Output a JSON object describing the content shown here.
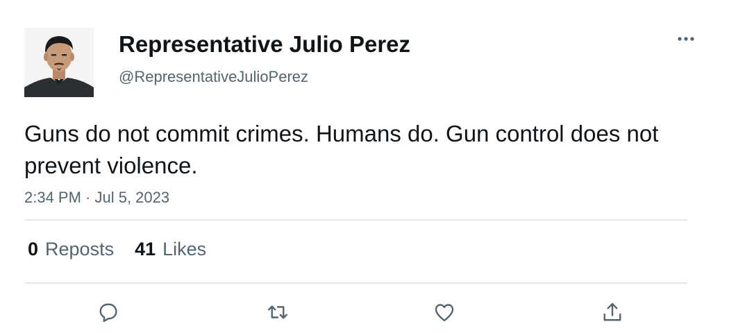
{
  "author": {
    "display_name": "Representative Julio Perez",
    "handle": "@RepresentativeJulioPerez",
    "avatar_icon": "profile-photo"
  },
  "tweet": {
    "text": "Guns do not commit crimes. Humans do. Gun control does not prevent violence.",
    "timestamp": "2:34 PM · Jul 5, 2023"
  },
  "stats": {
    "reposts_count": "0",
    "reposts_label": "Reposts",
    "likes_count": "41",
    "likes_label": "Likes"
  },
  "actions": [
    {
      "icon": "reply-icon"
    },
    {
      "icon": "repost-icon"
    },
    {
      "icon": "like-icon"
    },
    {
      "icon": "share-icon"
    }
  ],
  "colors": {
    "text_primary": "#0f1419",
    "text_secondary": "#536471",
    "divider": "#e6e9eb",
    "icon": "#536471"
  }
}
